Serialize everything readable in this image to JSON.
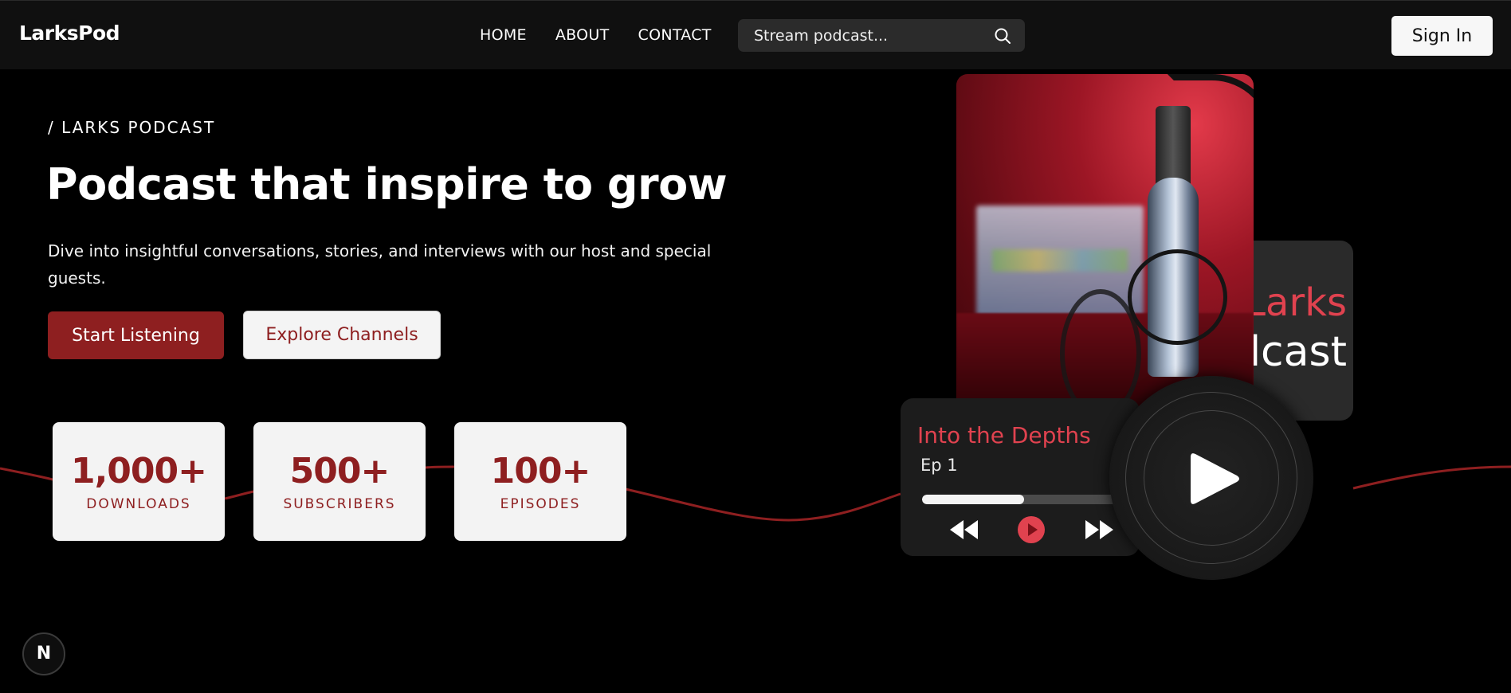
{
  "nav": {
    "brand": "LarksPod",
    "links": [
      "HOME",
      "ABOUT",
      "CONTACT"
    ],
    "search_placeholder": "Stream podcast...",
    "signin_label": "Sign In"
  },
  "hero": {
    "eyebrow": "/ LARKS PODCAST",
    "headline": "Podcast that inspire to grow",
    "subtext": "Dive into insightful conversations, stories, and interviews with our host and special guests.",
    "primary_cta": "Start Listening",
    "secondary_cta": "Explore Channels"
  },
  "stats": [
    {
      "value": "1,000+",
      "label": "DOWNLOADS"
    },
    {
      "value": "500+",
      "label": "SUBSCRIBERS"
    },
    {
      "value": "100+",
      "label": "EPISODES"
    }
  ],
  "art": {
    "brand_card_line1": "Larks",
    "brand_card_line2": "Podcast"
  },
  "player": {
    "title": "Into the Depths",
    "episode": "Ep 1",
    "progress": 0.5
  },
  "framework_badge": "N",
  "colors": {
    "accent": "#8e1f20",
    "accent_bright": "#e0424f",
    "background": "#000000",
    "nav_bg": "#101010"
  }
}
